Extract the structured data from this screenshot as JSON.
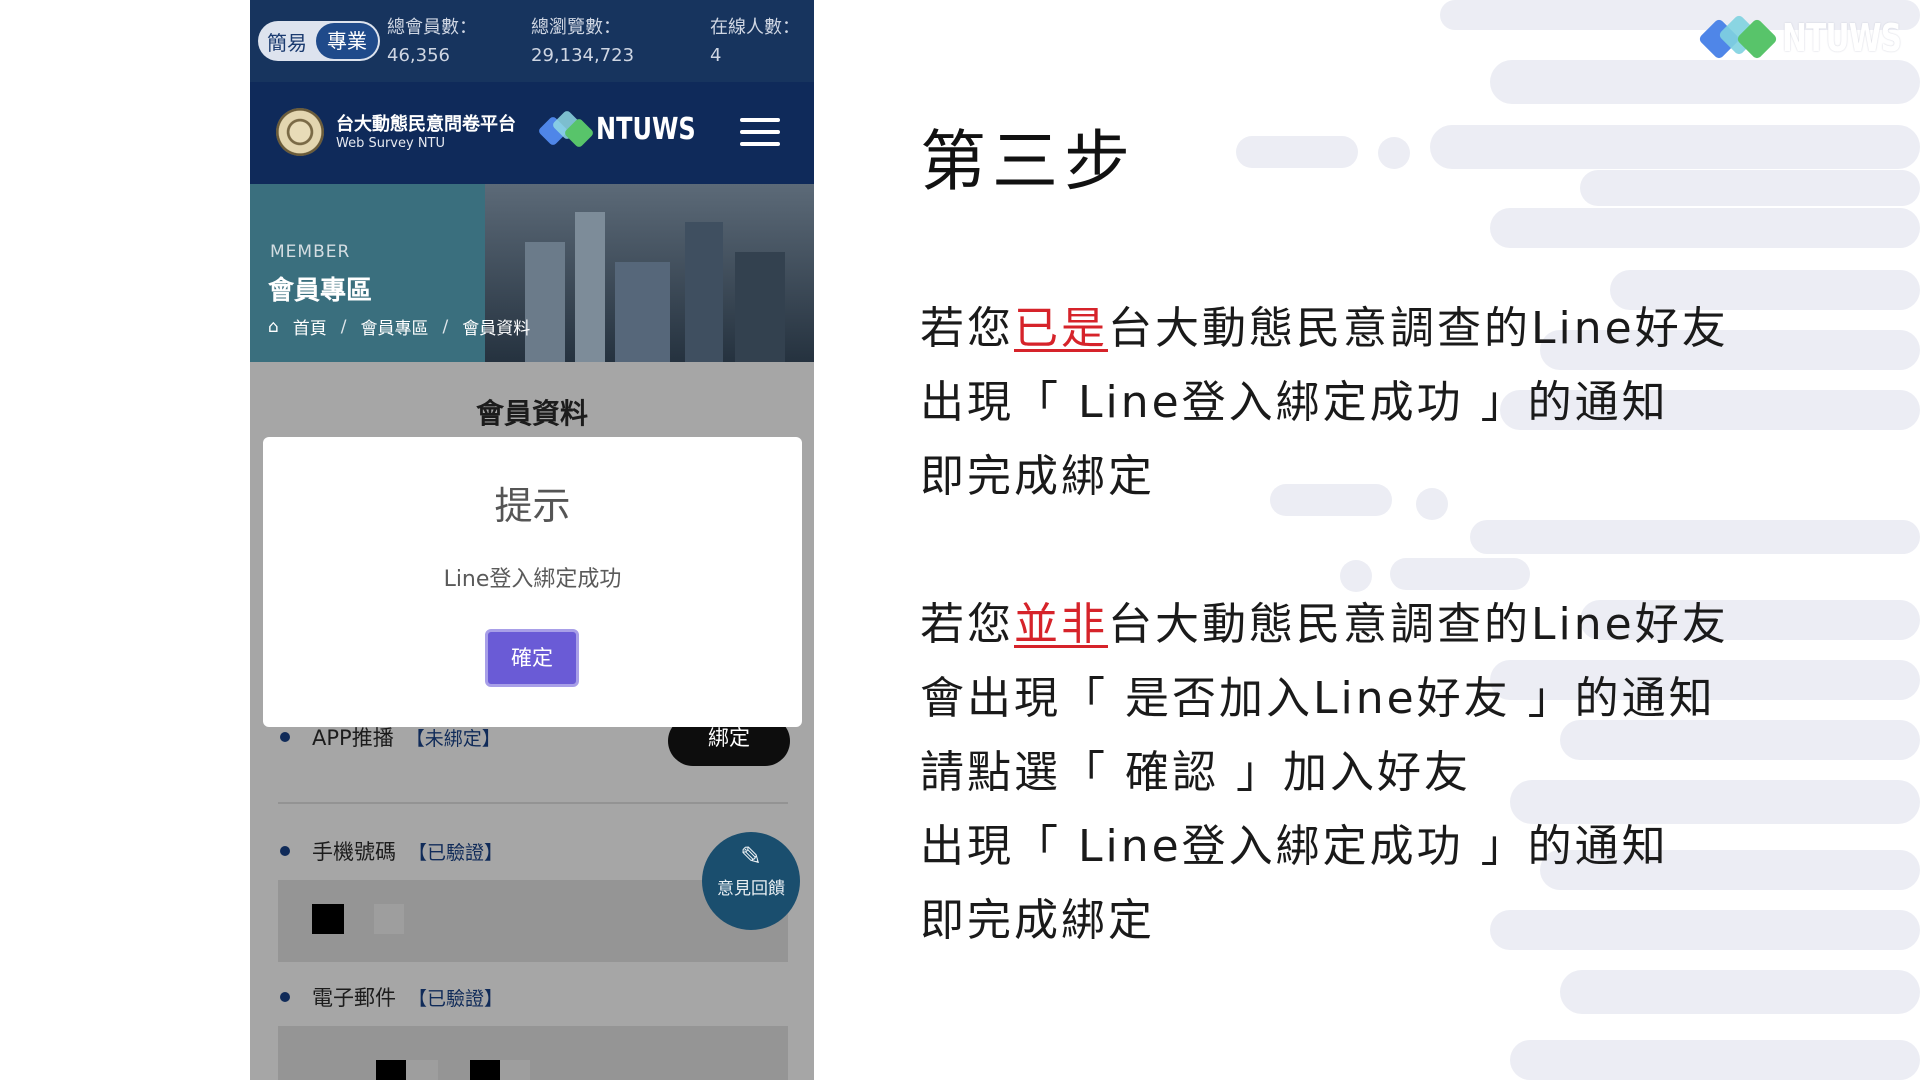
{
  "brand": {
    "logo_text": "NTUWS"
  },
  "phone": {
    "mode_toggle": {
      "simple": "簡易",
      "pro": "專業"
    },
    "stats": [
      {
        "label": "總會員數：",
        "value": "46,356"
      },
      {
        "label": "總瀏覽數：",
        "value": "29,134,723"
      },
      {
        "label": "在線人數：",
        "value": "4"
      }
    ],
    "navbar": {
      "site_title": "台大動態民意問卷平台",
      "site_subtitle": "Web Survey NTU",
      "logo_text": "NTUWS"
    },
    "hero": {
      "small_label": "MEMBER",
      "title": "會員專區",
      "breadcrumbs": [
        "首頁",
        "會員專區",
        "會員資料"
      ],
      "separator": "/"
    },
    "content": {
      "title": "會員資料",
      "rows": [
        {
          "label": "APP推播",
          "tag": "【未綁定】"
        },
        {
          "label": "手機號碼",
          "tag": "【已驗證】"
        },
        {
          "label": "電子郵件",
          "tag": "【已驗證】"
        }
      ],
      "bind_button": "綁定",
      "feedback_label": "意見回饋",
      "feedback_icon": "pencil-icon"
    },
    "modal": {
      "title": "提示",
      "message": "Line登入綁定成功",
      "ok_button": "確定"
    }
  },
  "instructions": {
    "step_title": "第三步",
    "para1": {
      "line1_pre": "若您",
      "line1_hl": "已是",
      "line1_post": "台大動態民意調查的Line好友",
      "line2": "出現「 Line登入綁定成功 」的通知",
      "line3": "即完成綁定"
    },
    "para2": {
      "line1_pre": "若您",
      "line1_hl": "並非",
      "line1_post": "台大動態民意調查的Line好友",
      "line2": "會出現「 是否加入Line好友 」的通知",
      "line3": "請點選「 確認 」加入好友",
      "line4": "出現「 Line登入綁定成功 」的通知",
      "line5": "即完成綁定"
    }
  },
  "colors": {
    "navy": "#0f2a5a",
    "highlight_red": "#d6232a",
    "modal_button": "#6a5bd6",
    "deco_gray": "#ecedf4"
  }
}
